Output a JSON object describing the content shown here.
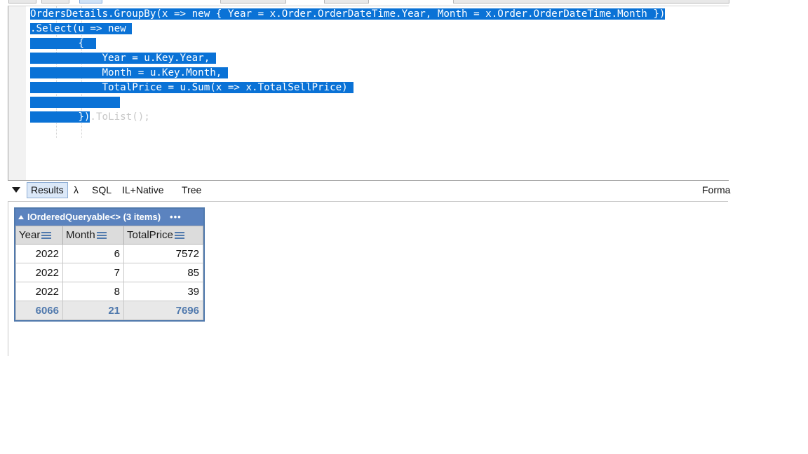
{
  "code": {
    "lines": [
      {
        "sel": "OrdersDetails.GroupBy(x => new { Year = x.Order.OrderDateTime.Year, Month = x.Order.OrderDateTime.Month })",
        "rest": ""
      },
      {
        "sel": ".Select(u => new ",
        "rest": ""
      },
      {
        "sel": "        {  ",
        "rest": ""
      },
      {
        "sel": "            Year = u.Key.Year, ",
        "rest": ""
      },
      {
        "sel": "            Month = u.Key.Month, ",
        "rest": ""
      },
      {
        "sel": "            TotalPrice = u.Sum(x => x.TotalSellPrice) ",
        "rest": ""
      },
      {
        "sel": "               ",
        "rest": ""
      },
      {
        "sel": "        })",
        "rest": ".ToList();"
      }
    ]
  },
  "tabs": {
    "results": "Results",
    "lambda": "λ",
    "sql": "SQL",
    "il_native": "IL+Native",
    "tree": "Tree",
    "format": "Forma"
  },
  "grid": {
    "title": "IOrderedQueryable<> (3 items)",
    "more": "•••",
    "columns": [
      "Year",
      "Month",
      "TotalPrice"
    ],
    "rows": [
      [
        "2022",
        "6",
        "7572"
      ],
      [
        "2022",
        "7",
        "85"
      ],
      [
        "2022",
        "8",
        "39"
      ]
    ],
    "totals": [
      "6066",
      "21",
      "7696"
    ]
  },
  "colors": {
    "selection": "#0a72d6",
    "grid_header": "#5b83bf",
    "grid_accent": "#5079ad"
  }
}
